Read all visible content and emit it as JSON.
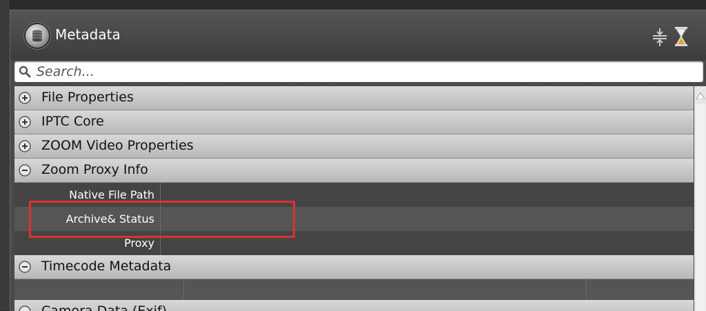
{
  "panel": {
    "title": "Metadata",
    "icons": [
      "database-icon",
      "collapse-icon",
      "hourglass-icon"
    ]
  },
  "search": {
    "placeholder": "Search..."
  },
  "sections": [
    {
      "label": "File Properties",
      "state": "collapsed"
    },
    {
      "label": "IPTC Core",
      "state": "collapsed"
    },
    {
      "label": "ZOOM Video Properties",
      "state": "collapsed"
    },
    {
      "label": "Zoom Proxy Info",
      "state": "expanded",
      "fields": [
        {
          "name": "Native File Path",
          "value": ""
        },
        {
          "name": "Archive& Status",
          "value": ""
        },
        {
          "name": "Proxy",
          "value": ""
        }
      ]
    },
    {
      "label": "Timecode Metadata",
      "state": "expanded"
    },
    {
      "label": "Camera Data (Exif)",
      "state": "collapsed"
    }
  ],
  "colors": {
    "highlight": "#e03030",
    "section_header": "#c8c8c8",
    "panel_bg": "#4a4a4a",
    "hourglass": "#e8a020"
  }
}
